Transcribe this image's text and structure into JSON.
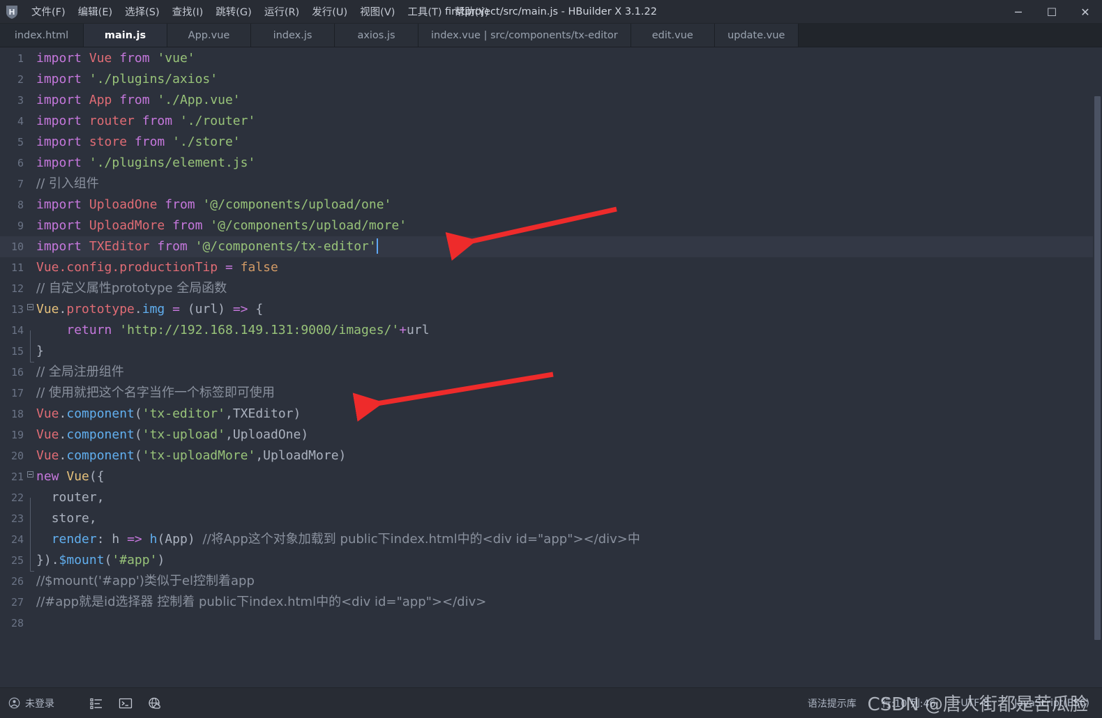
{
  "window": {
    "title": "firstproject/src/main.js - HBuilder X 3.1.22",
    "logo_letter": "H",
    "minimize": "─",
    "maximize": "☐",
    "close": "✕"
  },
  "menu": [
    {
      "label": "文件(F)",
      "name": "menu-file"
    },
    {
      "label": "编辑(E)",
      "name": "menu-edit"
    },
    {
      "label": "选择(S)",
      "name": "menu-select"
    },
    {
      "label": "查找(I)",
      "name": "menu-find"
    },
    {
      "label": "跳转(G)",
      "name": "menu-goto"
    },
    {
      "label": "运行(R)",
      "name": "menu-run"
    },
    {
      "label": "发行(U)",
      "name": "menu-publish"
    },
    {
      "label": "视图(V)",
      "name": "menu-view"
    },
    {
      "label": "工具(T)",
      "name": "menu-tools"
    },
    {
      "label": "帮助(Y)",
      "name": "menu-help"
    }
  ],
  "tabs": [
    {
      "label": "index.html",
      "active": false
    },
    {
      "label": "main.js",
      "active": true
    },
    {
      "label": "App.vue",
      "active": false
    },
    {
      "label": "index.js",
      "active": false
    },
    {
      "label": "axios.js",
      "active": false
    },
    {
      "label": "index.vue | src/components/tx-editor",
      "active": false
    },
    {
      "label": "edit.vue",
      "active": false
    },
    {
      "label": "update.vue",
      "active": false
    }
  ],
  "editor": {
    "current_line": 10,
    "total_lines": 28,
    "line_numbers": [
      1,
      2,
      3,
      4,
      5,
      6,
      7,
      8,
      9,
      10,
      11,
      12,
      13,
      14,
      15,
      16,
      17,
      18,
      19,
      20,
      21,
      22,
      23,
      24,
      25,
      26,
      27,
      28
    ],
    "lines": [
      "import Vue from 'vue'",
      "import './plugins/axios'",
      "import App from './App.vue'",
      "import router from './router'",
      "import store from './store'",
      "import './plugins/element.js'",
      "// 引入组件",
      "import UploadOne from '@/components/upload/one'",
      "import UploadMore from '@/components/upload/more'",
      "import TXEditor from '@/components/tx-editor'",
      "Vue.config.productionTip = false",
      "// 自定义属性prototype 全局函数",
      "Vue.prototype.img = (url) => {",
      "    return 'http://192.168.149.131:9000/images/'+url",
      "}",
      "// 全局注册组件",
      "// 使用就把这个名字当作一个标签即可使用",
      "Vue.component('tx-editor',TXEditor)",
      "Vue.component('tx-upload',UploadOne)",
      "Vue.component('tx-uploadMore',UploadMore)",
      "new Vue({",
      "  router,",
      "  store,",
      "  render: h => h(App) //将App这个对象加载到 public下index.html中的<div id=\"app\"></div>中",
      "}).$mount('#app')",
      "//$mount('#app')类似于el控制着app",
      "//#app就是id选择器 控制着 public下index.html中的<div id=\"app\"></div>",
      ""
    ]
  },
  "statusbar": {
    "login_label": "未登录",
    "user_icon": "user-circle-icon",
    "icons": [
      {
        "name": "outline-list-icon"
      },
      {
        "name": "terminal-icon"
      },
      {
        "name": "globe-cloud-icon"
      }
    ],
    "syntax_hint": "语法提示库",
    "position": "行:10  列:46",
    "encoding": "UTF-8",
    "language": "JavaScript(ES6)"
  },
  "watermark": "CSDN @唐人街都是苦瓜脸",
  "colors": {
    "bg_editor": "#2c313c",
    "bg_titlebar": "#282c34",
    "bg_tabbar": "#21252b",
    "current_line": "#333845",
    "keyword": "#c678dd",
    "string": "#98c379",
    "comment": "#8a919e",
    "identifier": "#e06c75",
    "function": "#61afef",
    "class": "#e5c07b",
    "number": "#d19a66",
    "arrow_red": "#ee2b2b",
    "cursor": "#5fa8f5"
  }
}
